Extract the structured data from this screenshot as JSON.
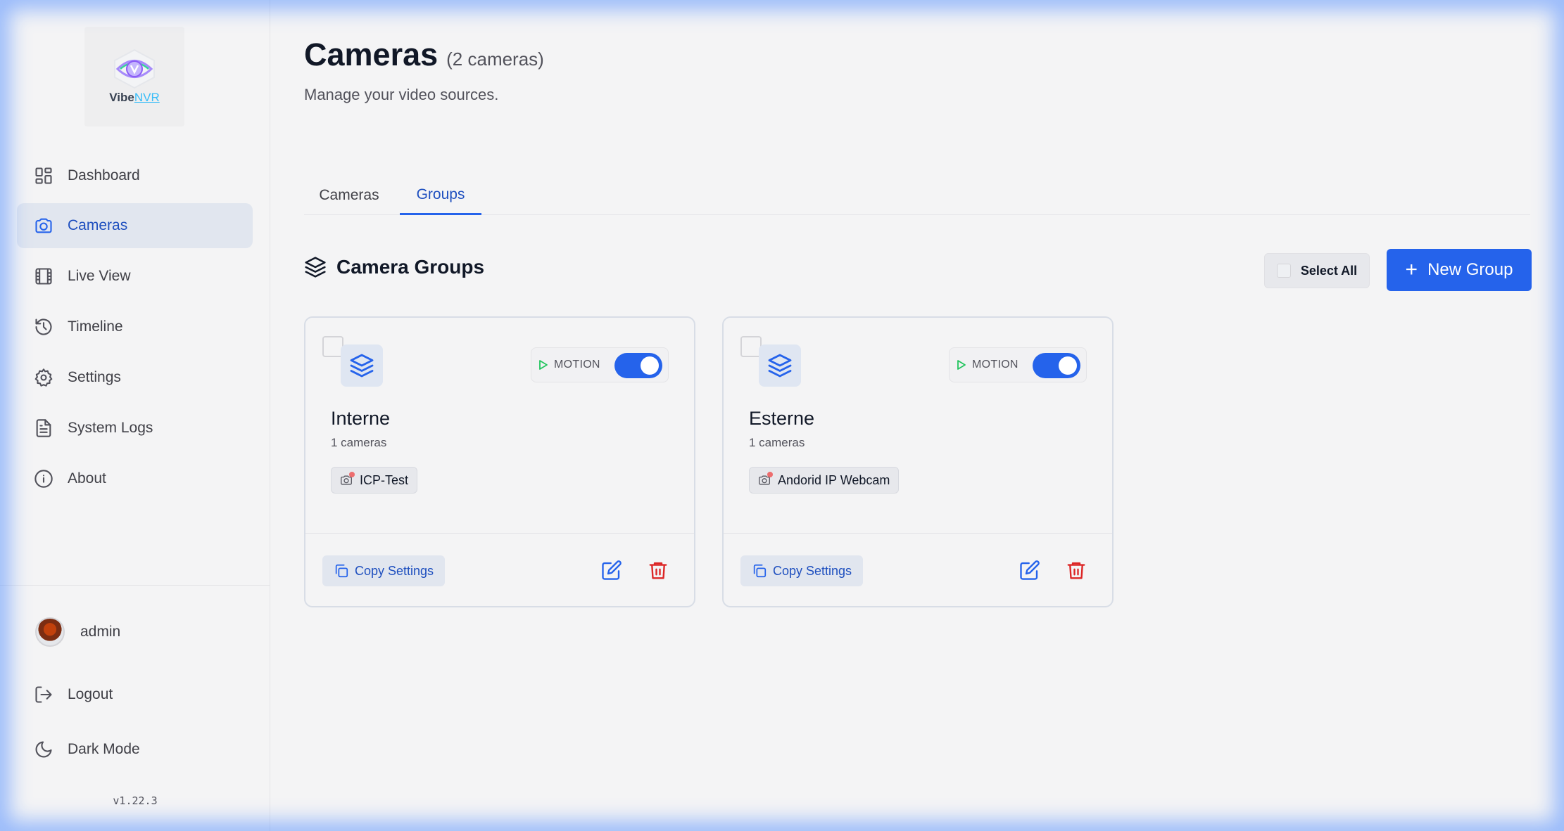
{
  "brand": {
    "name_part1": "Vibe",
    "name_part2": "NVR"
  },
  "sidebar": {
    "items": [
      {
        "label": "Dashboard",
        "icon": "dashboard-icon",
        "active": false
      },
      {
        "label": "Cameras",
        "icon": "camera-icon",
        "active": true
      },
      {
        "label": "Live View",
        "icon": "film-icon",
        "active": false
      },
      {
        "label": "Timeline",
        "icon": "history-icon",
        "active": false
      },
      {
        "label": "Settings",
        "icon": "gear-icon",
        "active": false
      },
      {
        "label": "System Logs",
        "icon": "document-icon",
        "active": false
      },
      {
        "label": "About",
        "icon": "info-icon",
        "active": false
      }
    ],
    "user": {
      "name": "admin"
    },
    "logout_label": "Logout",
    "dark_mode_label": "Dark Mode",
    "version": "v1.22.3"
  },
  "header": {
    "title": "Cameras",
    "count": "(2 cameras)",
    "subtitle": "Manage your video sources."
  },
  "tabs": [
    {
      "label": "Cameras",
      "active": false
    },
    {
      "label": "Groups",
      "active": true
    }
  ],
  "section": {
    "title": "Camera Groups",
    "select_all_label": "Select All",
    "new_group_label": "New Group"
  },
  "groups": [
    {
      "name": "Interne",
      "count": "1 cameras",
      "motion_label": "MOTION",
      "motion_enabled": true,
      "cameras": [
        "ICP-Test"
      ],
      "copy_label": "Copy Settings"
    },
    {
      "name": "Esterne",
      "count": "1 cameras",
      "motion_label": "MOTION",
      "motion_enabled": true,
      "cameras": [
        "Andorid IP Webcam"
      ],
      "copy_label": "Copy Settings"
    }
  ],
  "colors": {
    "accent": "#2563eb",
    "danger": "#dc2626",
    "motion_play": "#22c55e"
  }
}
